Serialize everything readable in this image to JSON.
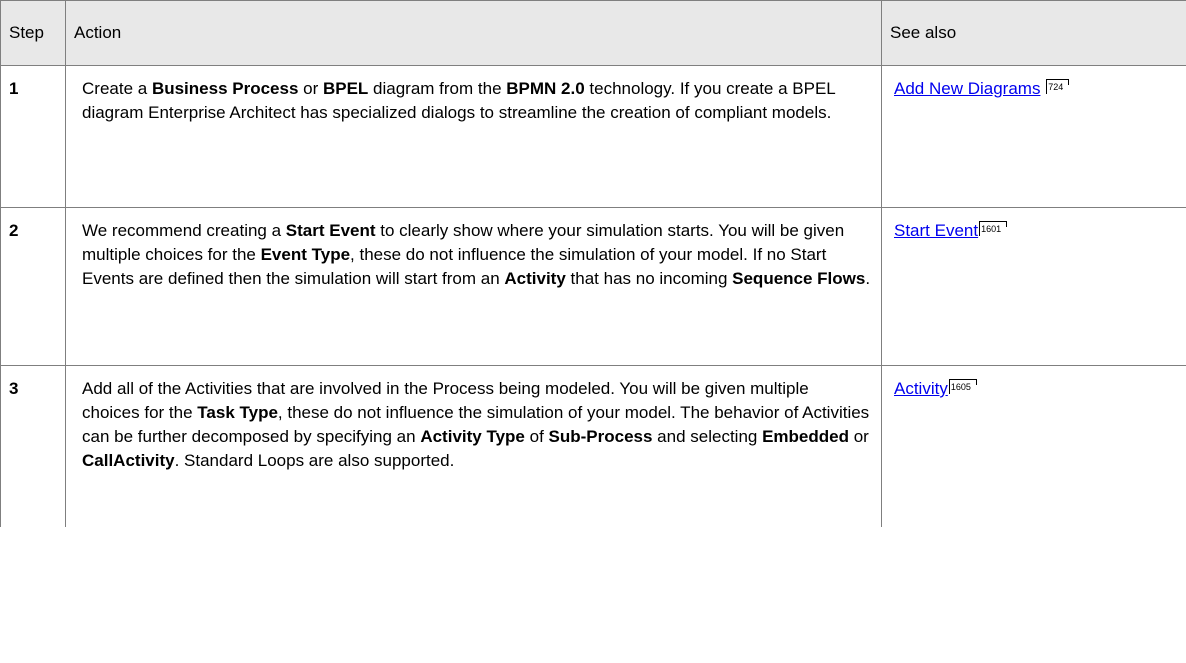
{
  "headers": {
    "step": "Step",
    "action": "Action",
    "see_also": "See also"
  },
  "rows": [
    {
      "step": "1",
      "action": [
        {
          "t": "Create a "
        },
        {
          "t": "Business Process",
          "b": true
        },
        {
          "t": " or "
        },
        {
          "t": "BPEL",
          "b": true
        },
        {
          "t": " diagram from the "
        },
        {
          "t": "BPMN 2.0",
          "b": true
        },
        {
          "t": " technology. If you create a BPEL diagram Enterprise Architect has specialized dialogs to streamline the creation of compliant models."
        }
      ],
      "see_also": {
        "label": "Add New Diagrams",
        "page": "724"
      }
    },
    {
      "step": "2",
      "action": [
        {
          "t": "We recommend creating a "
        },
        {
          "t": "Start Event",
          "b": true
        },
        {
          "t": " to clearly show where your simulation starts. You will be given multiple choices for the "
        },
        {
          "t": "Event Type",
          "b": true
        },
        {
          "t": ", these do not influence the simulation of your model. If no Start Events are defined then the simulation will start from an "
        },
        {
          "t": "Activity",
          "b": true
        },
        {
          "t": " that has no incoming "
        },
        {
          "t": "Sequence Flows",
          "b": true
        },
        {
          "t": "."
        }
      ],
      "see_also": {
        "label": "Start Event",
        "page": "1601"
      }
    },
    {
      "step": "3",
      "action": [
        {
          "t": "Add all of the Activities that are involved in the Process being modeled. You will be given multiple choices for the "
        },
        {
          "t": "Task Type",
          "b": true
        },
        {
          "t": ", these do not influence the simulation of your model. The behavior of Activities can be further decomposed by specifying an "
        },
        {
          "t": "Activity Type",
          "b": true
        },
        {
          "t": " of "
        },
        {
          "t": "Sub-Process",
          "b": true
        },
        {
          "t": " and selecting "
        },
        {
          "t": "Embedded",
          "b": true
        },
        {
          "t": " or "
        },
        {
          "t": "CallActivity",
          "b": true
        },
        {
          "t": ". Standard Loops are also supported."
        }
      ],
      "see_also": {
        "label": "Activity",
        "page": "1605"
      }
    }
  ]
}
